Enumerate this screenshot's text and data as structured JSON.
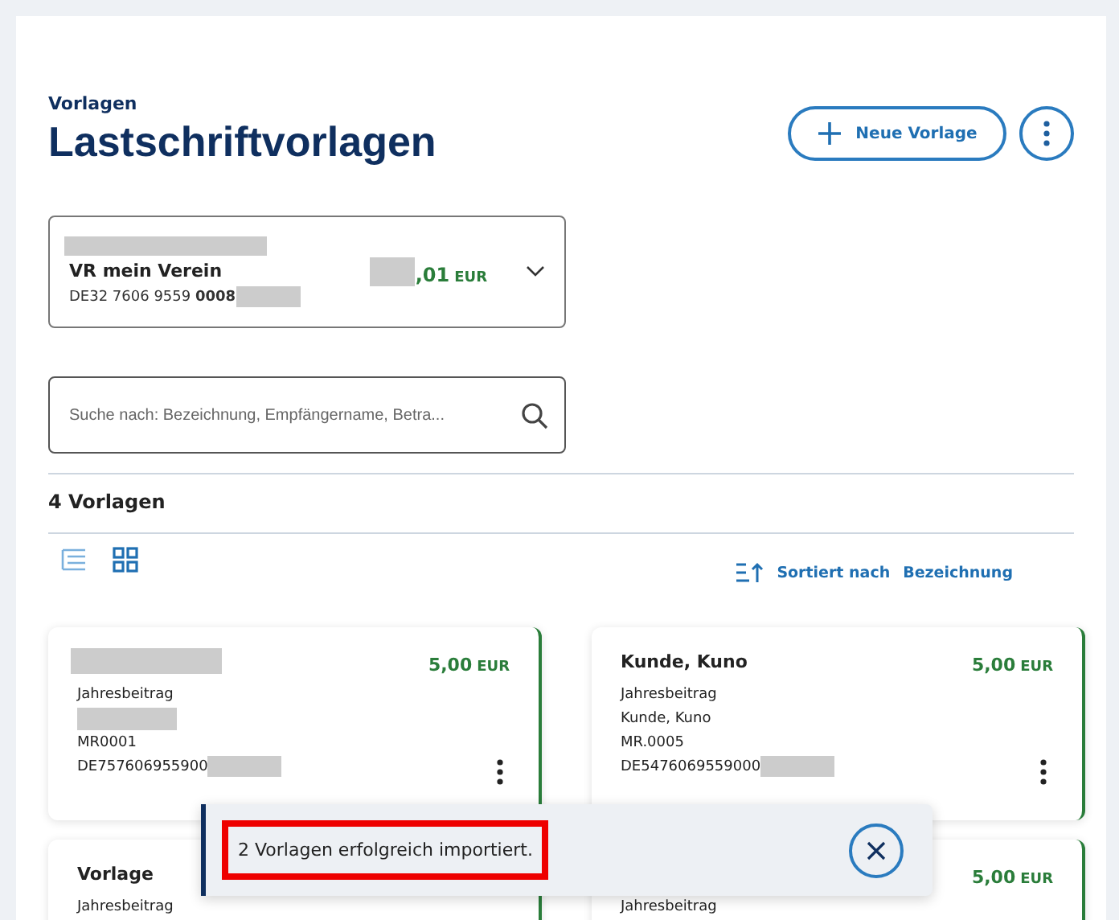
{
  "header": {
    "breadcrumb": "Vorlagen",
    "title": "Lastschriftvorlagen",
    "new_button": "Neue Vorlage"
  },
  "account": {
    "name": "VR mein Verein",
    "iban": "DE32 7606 9559 **0008**",
    "amount": ",01",
    "currency": "EUR",
    "expanded": false
  },
  "search": {
    "placeholder": "Suche nach: Bezeichnung, Empfängername, Betra..."
  },
  "count": "4 Vorlagen",
  "view_toggle": [
    {
      "kind": "list",
      "selected": false
    },
    {
      "kind": "grid",
      "selected": true
    }
  ],
  "sort": {
    "label": "Sortiert nach",
    "value": "Bezeichnung"
  },
  "cards": [
    {
      "amount": "5,00",
      "currency": "EUR",
      "lines": [
        {
          "kind": "text",
          "text": "Jahresbeitrag"
        },
        {
          "kind": "redacted"
        },
        {
          "kind": "text",
          "text": "MR0001"
        },
        {
          "kind": "iban",
          "text": "DE757606955900"
        }
      ]
    },
    {
      "title": "Kunde, Kuno",
      "amount": "5,00",
      "currency": "EUR",
      "lines": [
        {
          "kind": "text",
          "text": "Jahresbeitrag"
        },
        {
          "kind": "text",
          "text": "Kunde, Kuno"
        },
        {
          "kind": "text",
          "text": "MR.0005"
        },
        {
          "kind": "iban",
          "text": "DE5476069559000"
        }
      ]
    },
    {
      "title": "Vorlage",
      "lines": [
        {
          "kind": "text",
          "text": "Jahresbeitrag"
        }
      ]
    },
    {
      "amount": "5,00",
      "currency": "EUR",
      "lines": [
        {
          "kind": "text",
          "text": "Jahresbeitrag"
        }
      ]
    }
  ],
  "toast": {
    "message": "2 Vorlagen erfolgreich importiert.",
    "highlighted": true
  }
}
